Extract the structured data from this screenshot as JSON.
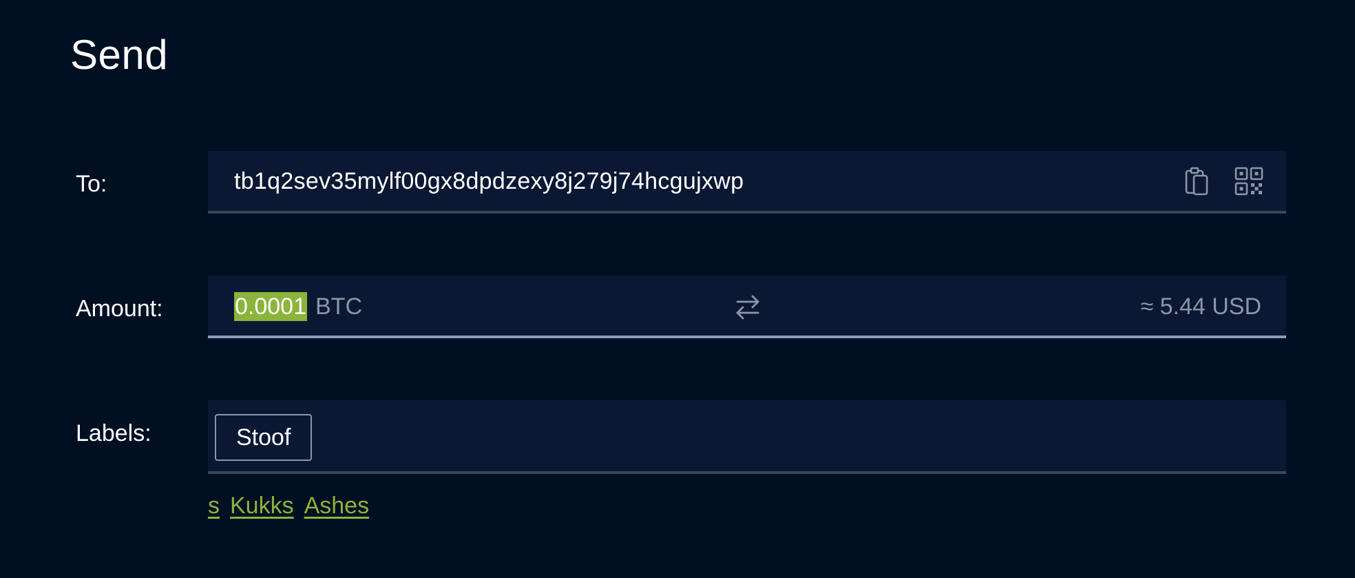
{
  "page": {
    "title": "Send"
  },
  "to": {
    "label": "To:",
    "address": "tb1q2sev35mylf00gx8dpdzexy8j279j74hcgujxwp",
    "paste_icon": "clipboard-icon",
    "scan_icon": "qr-code-icon"
  },
  "amount": {
    "label": "Amount:",
    "value": "0.0001",
    "unit": "BTC",
    "swap_icon": "swap-arrows-icon",
    "fiat": "≈ 5.44 USD"
  },
  "labels": {
    "label": "Labels:",
    "chips": [
      "Stoof"
    ],
    "suggestions": [
      "s",
      "Kukks",
      "Ashes"
    ]
  },
  "colors": {
    "background": "#010f23",
    "field_background": "#0a1834",
    "accent": "#8bb43a",
    "muted_text": "#8d96a5"
  }
}
